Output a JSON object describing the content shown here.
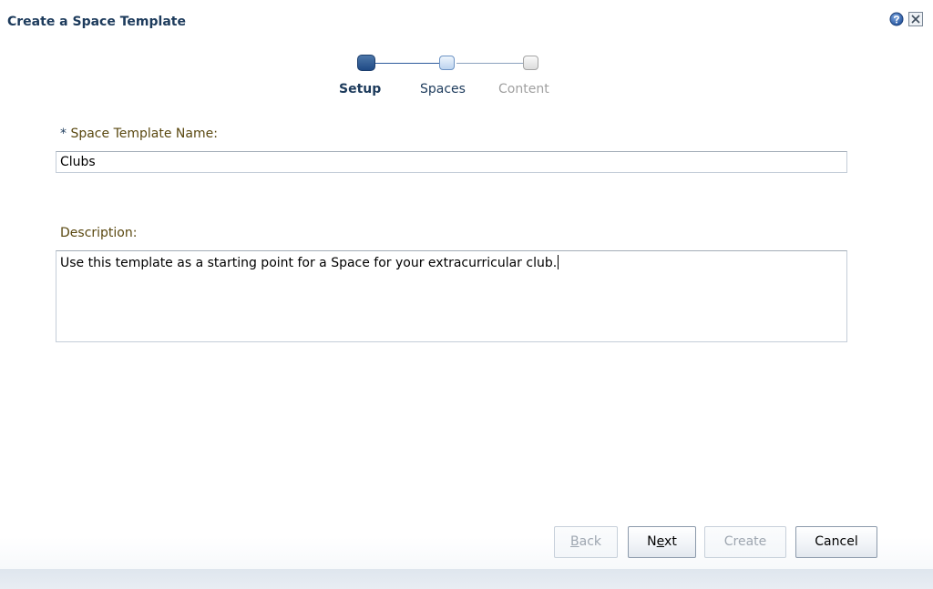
{
  "dialog": {
    "title": "Create a Space Template"
  },
  "icons": {
    "help": "help-icon",
    "close": "close-icon"
  },
  "train": {
    "steps": [
      {
        "label": "Setup",
        "state": "current"
      },
      {
        "label": "Spaces",
        "state": "next"
      },
      {
        "label": "Content",
        "state": "disabled"
      }
    ]
  },
  "form": {
    "name_required_marker": "*",
    "name_label": "Space Template Name:",
    "name_value": "Clubs",
    "description_label": "Description:",
    "description_value": "Use this template as a starting point for a Space for your extracurricular club."
  },
  "buttons": {
    "back": {
      "prefix": "",
      "accel": "B",
      "rest": "ack",
      "enabled": false
    },
    "next": {
      "prefix": "N",
      "accel": "e",
      "rest": "xt",
      "enabled": true
    },
    "create": {
      "label": "Create",
      "enabled": false
    },
    "cancel": {
      "label": "Cancel",
      "enabled": true
    }
  },
  "colors": {
    "title": "#1d3b5c",
    "label": "#5a4810",
    "current_step": "#1f4a85",
    "disabled_text": "#9ea6b0"
  }
}
